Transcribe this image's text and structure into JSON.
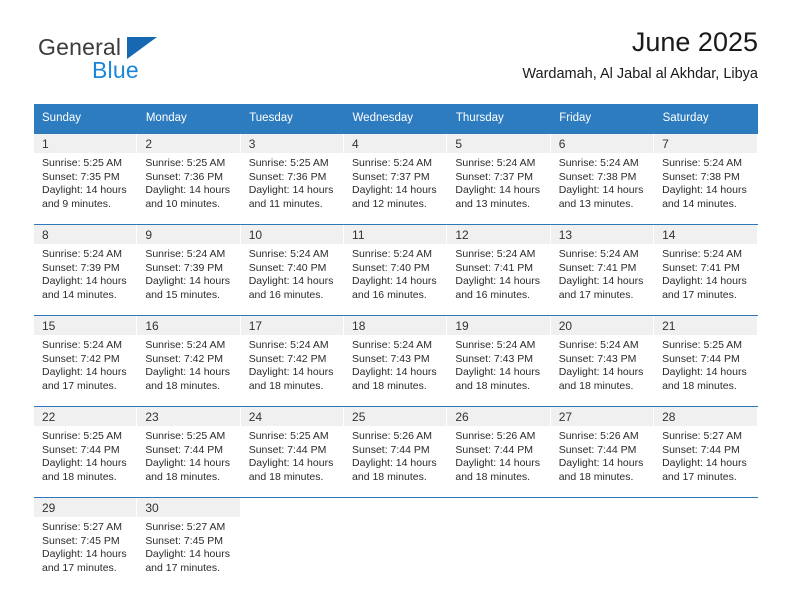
{
  "brand": {
    "name_top": "General",
    "name_bottom": "Blue",
    "color_dark": "#3c3c3c",
    "color_blue": "#1c86d8",
    "triangle_color": "#1668b3"
  },
  "header": {
    "title": "June 2025",
    "subtitle": "Wardamah, Al Jabal al Akhdar, Libya",
    "header_bg": "#2e7cc0",
    "row_divider_color": "#3278b8",
    "daynum_bg": "#f0f0f0"
  },
  "weekday_headers": [
    "Sunday",
    "Monday",
    "Tuesday",
    "Wednesday",
    "Thursday",
    "Friday",
    "Saturday"
  ],
  "weeks": [
    {
      "days": [
        {
          "num": "1",
          "l1": "Sunrise: 5:25 AM",
          "l2": "Sunset: 7:35 PM",
          "l3": "Daylight: 14 hours",
          "l4": "and 9 minutes."
        },
        {
          "num": "2",
          "l1": "Sunrise: 5:25 AM",
          "l2": "Sunset: 7:36 PM",
          "l3": "Daylight: 14 hours",
          "l4": "and 10 minutes."
        },
        {
          "num": "3",
          "l1": "Sunrise: 5:25 AM",
          "l2": "Sunset: 7:36 PM",
          "l3": "Daylight: 14 hours",
          "l4": "and 11 minutes."
        },
        {
          "num": "4",
          "l1": "Sunrise: 5:24 AM",
          "l2": "Sunset: 7:37 PM",
          "l3": "Daylight: 14 hours",
          "l4": "and 12 minutes."
        },
        {
          "num": "5",
          "l1": "Sunrise: 5:24 AM",
          "l2": "Sunset: 7:37 PM",
          "l3": "Daylight: 14 hours",
          "l4": "and 13 minutes."
        },
        {
          "num": "6",
          "l1": "Sunrise: 5:24 AM",
          "l2": "Sunset: 7:38 PM",
          "l3": "Daylight: 14 hours",
          "l4": "and 13 minutes."
        },
        {
          "num": "7",
          "l1": "Sunrise: 5:24 AM",
          "l2": "Sunset: 7:38 PM",
          "l3": "Daylight: 14 hours",
          "l4": "and 14 minutes."
        }
      ]
    },
    {
      "days": [
        {
          "num": "8",
          "l1": "Sunrise: 5:24 AM",
          "l2": "Sunset: 7:39 PM",
          "l3": "Daylight: 14 hours",
          "l4": "and 14 minutes."
        },
        {
          "num": "9",
          "l1": "Sunrise: 5:24 AM",
          "l2": "Sunset: 7:39 PM",
          "l3": "Daylight: 14 hours",
          "l4": "and 15 minutes."
        },
        {
          "num": "10",
          "l1": "Sunrise: 5:24 AM",
          "l2": "Sunset: 7:40 PM",
          "l3": "Daylight: 14 hours",
          "l4": "and 16 minutes."
        },
        {
          "num": "11",
          "l1": "Sunrise: 5:24 AM",
          "l2": "Sunset: 7:40 PM",
          "l3": "Daylight: 14 hours",
          "l4": "and 16 minutes."
        },
        {
          "num": "12",
          "l1": "Sunrise: 5:24 AM",
          "l2": "Sunset: 7:41 PM",
          "l3": "Daylight: 14 hours",
          "l4": "and 16 minutes."
        },
        {
          "num": "13",
          "l1": "Sunrise: 5:24 AM",
          "l2": "Sunset: 7:41 PM",
          "l3": "Daylight: 14 hours",
          "l4": "and 17 minutes."
        },
        {
          "num": "14",
          "l1": "Sunrise: 5:24 AM",
          "l2": "Sunset: 7:41 PM",
          "l3": "Daylight: 14 hours",
          "l4": "and 17 minutes."
        }
      ]
    },
    {
      "days": [
        {
          "num": "15",
          "l1": "Sunrise: 5:24 AM",
          "l2": "Sunset: 7:42 PM",
          "l3": "Daylight: 14 hours",
          "l4": "and 17 minutes."
        },
        {
          "num": "16",
          "l1": "Sunrise: 5:24 AM",
          "l2": "Sunset: 7:42 PM",
          "l3": "Daylight: 14 hours",
          "l4": "and 18 minutes."
        },
        {
          "num": "17",
          "l1": "Sunrise: 5:24 AM",
          "l2": "Sunset: 7:42 PM",
          "l3": "Daylight: 14 hours",
          "l4": "and 18 minutes."
        },
        {
          "num": "18",
          "l1": "Sunrise: 5:24 AM",
          "l2": "Sunset: 7:43 PM",
          "l3": "Daylight: 14 hours",
          "l4": "and 18 minutes."
        },
        {
          "num": "19",
          "l1": "Sunrise: 5:24 AM",
          "l2": "Sunset: 7:43 PM",
          "l3": "Daylight: 14 hours",
          "l4": "and 18 minutes."
        },
        {
          "num": "20",
          "l1": "Sunrise: 5:24 AM",
          "l2": "Sunset: 7:43 PM",
          "l3": "Daylight: 14 hours",
          "l4": "and 18 minutes."
        },
        {
          "num": "21",
          "l1": "Sunrise: 5:25 AM",
          "l2": "Sunset: 7:44 PM",
          "l3": "Daylight: 14 hours",
          "l4": "and 18 minutes."
        }
      ]
    },
    {
      "days": [
        {
          "num": "22",
          "l1": "Sunrise: 5:25 AM",
          "l2": "Sunset: 7:44 PM",
          "l3": "Daylight: 14 hours",
          "l4": "and 18 minutes."
        },
        {
          "num": "23",
          "l1": "Sunrise: 5:25 AM",
          "l2": "Sunset: 7:44 PM",
          "l3": "Daylight: 14 hours",
          "l4": "and 18 minutes."
        },
        {
          "num": "24",
          "l1": "Sunrise: 5:25 AM",
          "l2": "Sunset: 7:44 PM",
          "l3": "Daylight: 14 hours",
          "l4": "and 18 minutes."
        },
        {
          "num": "25",
          "l1": "Sunrise: 5:26 AM",
          "l2": "Sunset: 7:44 PM",
          "l3": "Daylight: 14 hours",
          "l4": "and 18 minutes."
        },
        {
          "num": "26",
          "l1": "Sunrise: 5:26 AM",
          "l2": "Sunset: 7:44 PM",
          "l3": "Daylight: 14 hours",
          "l4": "and 18 minutes."
        },
        {
          "num": "27",
          "l1": "Sunrise: 5:26 AM",
          "l2": "Sunset: 7:44 PM",
          "l3": "Daylight: 14 hours",
          "l4": "and 18 minutes."
        },
        {
          "num": "28",
          "l1": "Sunrise: 5:27 AM",
          "l2": "Sunset: 7:44 PM",
          "l3": "Daylight: 14 hours",
          "l4": "and 17 minutes."
        }
      ]
    },
    {
      "days": [
        {
          "num": "29",
          "l1": "Sunrise: 5:27 AM",
          "l2": "Sunset: 7:45 PM",
          "l3": "Daylight: 14 hours",
          "l4": "and 17 minutes."
        },
        {
          "num": "30",
          "l1": "Sunrise: 5:27 AM",
          "l2": "Sunset: 7:45 PM",
          "l3": "Daylight: 14 hours",
          "l4": "and 17 minutes."
        },
        {
          "num": "",
          "l1": "",
          "l2": "",
          "l3": "",
          "l4": ""
        },
        {
          "num": "",
          "l1": "",
          "l2": "",
          "l3": "",
          "l4": ""
        },
        {
          "num": "",
          "l1": "",
          "l2": "",
          "l3": "",
          "l4": ""
        },
        {
          "num": "",
          "l1": "",
          "l2": "",
          "l3": "",
          "l4": ""
        },
        {
          "num": "",
          "l1": "",
          "l2": "",
          "l3": "",
          "l4": ""
        }
      ]
    }
  ]
}
